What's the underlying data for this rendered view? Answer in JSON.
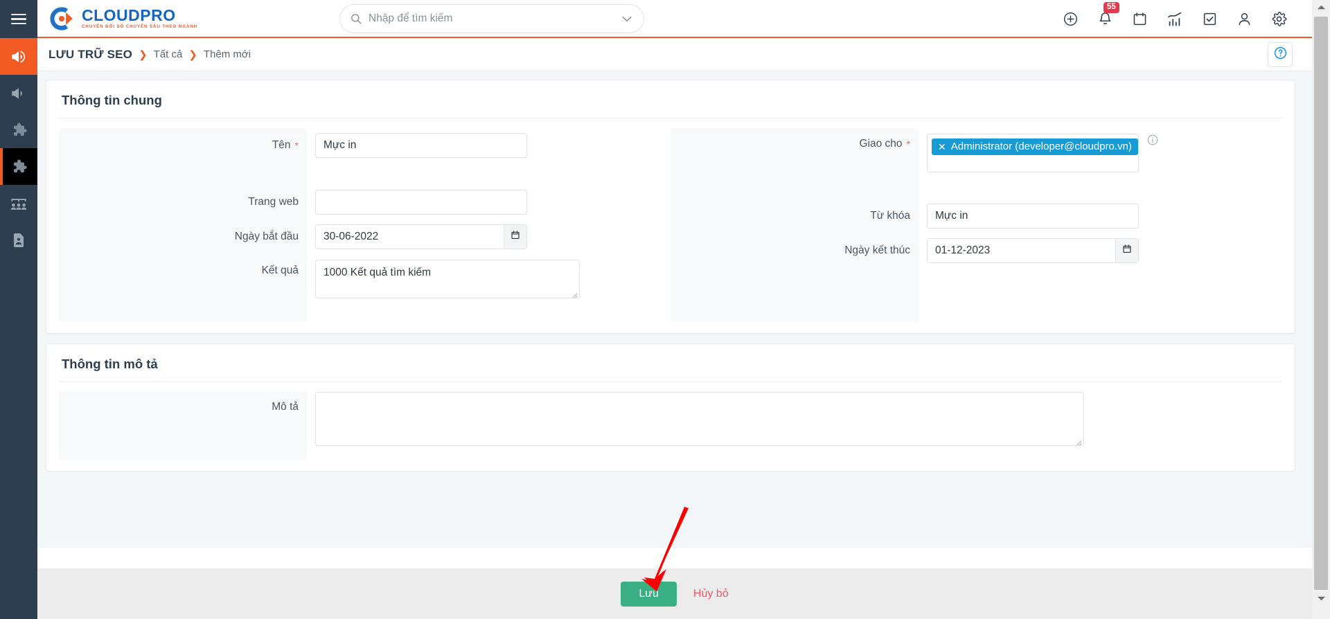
{
  "colors": {
    "rail_bg": "#2e3e4e",
    "accent_orange": "#f15a22",
    "brand_blue": "#1565c0",
    "tag_blue": "#169bd5",
    "save_green": "#3aaf85",
    "cancel_red": "#ea5a6b",
    "badge_red": "#e23b4e",
    "required_red": "#f06070"
  },
  "rail": {
    "burger": "menu-icon",
    "items": [
      {
        "icon": "megaphone-icon",
        "state": "active-orange"
      },
      {
        "icon": "megaphone-icon",
        "state": "default"
      },
      {
        "icon": "puzzle-icon",
        "state": "default"
      },
      {
        "icon": "puzzle-icon",
        "state": "active-dark"
      },
      {
        "icon": "users-group-icon",
        "state": "default"
      },
      {
        "icon": "document-user-icon",
        "state": "default"
      }
    ]
  },
  "topbar": {
    "logo": {
      "word": "CLOUDPRO",
      "tagline": "CHUYỂN ĐỔI SỐ CHUYÊN SÂU THEO NGÀNH"
    },
    "search": {
      "placeholder": "Nhập để tìm kiếm",
      "value": ""
    },
    "icons": [
      {
        "name": "add-circle-icon"
      },
      {
        "name": "bell-icon",
        "badge": "55"
      },
      {
        "name": "calendar-icon"
      },
      {
        "name": "analytics-icon"
      },
      {
        "name": "task-checkbox-icon"
      },
      {
        "name": "user-icon"
      },
      {
        "name": "gear-icon"
      }
    ]
  },
  "breadcrumb": {
    "title": "LƯU TRỮ SEO",
    "sep": "❯",
    "items": [
      "Tất cả",
      "Thêm mới"
    ],
    "help": "?"
  },
  "sections": {
    "general": {
      "title": "Thông tin chung",
      "left_fields": [
        {
          "label": "Tên",
          "required": "*",
          "value": "Mực in",
          "type": "text"
        },
        {
          "label": "Trang web",
          "required": "",
          "value": "",
          "type": "text"
        },
        {
          "label": "Ngày bắt đầu",
          "required": "",
          "value": "30-06-2022",
          "type": "date"
        },
        {
          "label": "Kết quả",
          "required": "",
          "value": "1000 Kết quả tìm kiếm",
          "type": "textarea"
        }
      ],
      "right_fields": [
        {
          "label": "Giao cho",
          "required": "*",
          "value": "Administrator (developer@cloudpro.vn)",
          "type": "tag"
        },
        {
          "label": "Từ khóa",
          "required": "",
          "value": "Mực in",
          "type": "text"
        },
        {
          "label": "Ngày kết thúc",
          "required": "",
          "value": "01-12-2023",
          "type": "date"
        }
      ]
    },
    "description": {
      "title": "Thông tin mô tả",
      "field": {
        "label": "Mô tả",
        "required": "",
        "value": "",
        "type": "textarea"
      }
    }
  },
  "footer": {
    "save_label": "Lưu",
    "cancel_label": "Hủy bỏ"
  }
}
